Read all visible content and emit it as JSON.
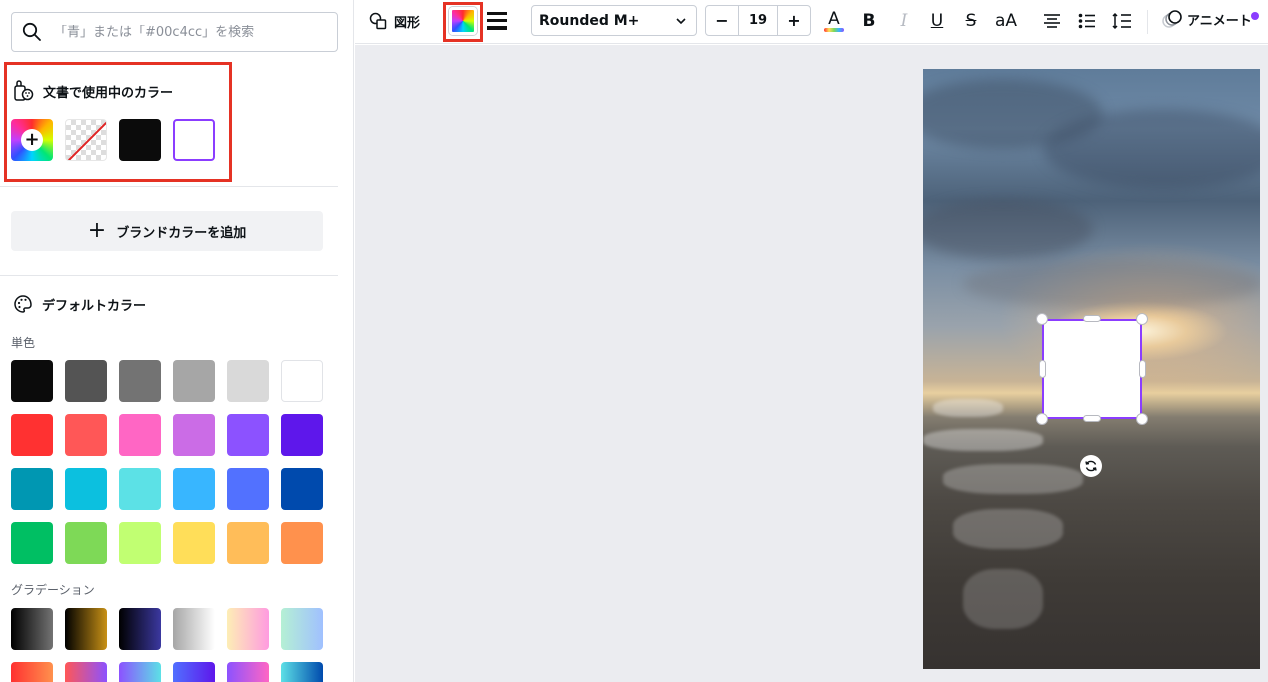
{
  "search": {
    "placeholder": "「青」または「#00c4cc」を検索"
  },
  "document_colors": {
    "title": "文書で使用中のカラー",
    "swatches": [
      {
        "kind": "add",
        "icon": "plus-icon"
      },
      {
        "kind": "transparent"
      },
      {
        "kind": "color",
        "color": "#0b0b0b"
      },
      {
        "kind": "color",
        "color": "#ffffff",
        "selected": true,
        "border": "#8b3dff"
      }
    ]
  },
  "brand": {
    "add_label": "ブランドカラーを追加"
  },
  "default_colors": {
    "title": "デフォルトカラー",
    "solid_label": "単色",
    "solid": [
      [
        "#0b0b0b",
        "#545454",
        "#737373",
        "#a6a6a6",
        "#d9d9d9",
        "#ffffff"
      ],
      [
        "#ff3131",
        "#ff5757",
        "#ff66c4",
        "#cb6ce6",
        "#8c52ff",
        "#5e17eb"
      ],
      [
        "#0097b2",
        "#0cc0df",
        "#5ce1e6",
        "#38b6ff",
        "#5271ff",
        "#004aad"
      ],
      [
        "#00bf63",
        "#7ed957",
        "#c1ff72",
        "#ffde59",
        "#ffbd59",
        "#ff914d"
      ]
    ],
    "gradient_label": "グラデーション",
    "gradients": [
      [
        [
          "#000000",
          "#737373"
        ],
        [
          "#000000",
          "#c89116"
        ],
        [
          "#000000",
          "#3b38a0"
        ],
        [
          "#a6a6a6",
          "#ffffff"
        ],
        [
          "#fdeeb5",
          "#ff9be0"
        ],
        [
          "#b5f0d4",
          "#a0c0ff"
        ]
      ],
      [
        [
          "#ff3131",
          "#ff914d"
        ],
        [
          "#ff5757",
          "#8c52ff"
        ],
        [
          "#8c52ff",
          "#5ce1e6"
        ],
        [
          "#5170ff",
          "#5e17eb"
        ],
        [
          "#8c52ff",
          "#ff66c4"
        ],
        [
          "#5de0e6",
          "#004aad"
        ]
      ]
    ]
  },
  "toolbar": {
    "shape_label": "図形",
    "font_name": "Rounded M+",
    "font_size": "19",
    "minus": "−",
    "plus": "+",
    "bold": "B",
    "italic": "I",
    "underline": "U",
    "strike": "S",
    "case": "aA",
    "animate_label": "アニメート",
    "accent": "#8b3dff"
  }
}
